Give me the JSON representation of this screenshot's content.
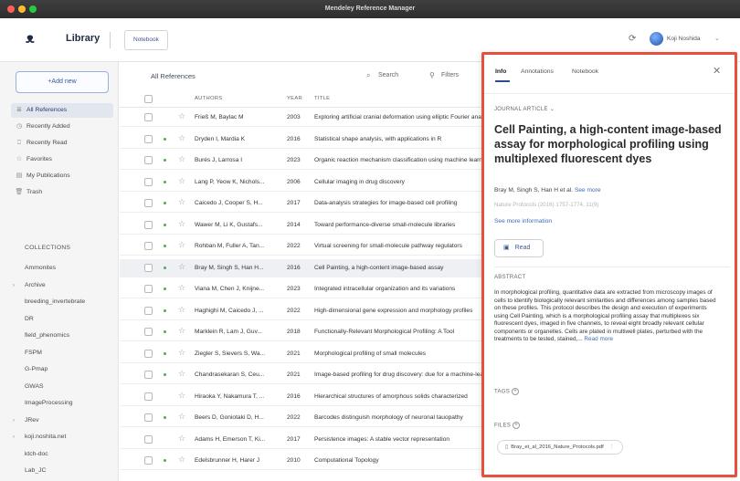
{
  "window": {
    "title": "Mendeley Reference Manager"
  },
  "header": {
    "library_label": "Library",
    "notebook_tab": "Notebook",
    "user_name": "Koji Noshida"
  },
  "sidebar": {
    "add_new": "+Add new",
    "nav": [
      {
        "label": "All References",
        "icon": "list-icon",
        "active": true
      },
      {
        "label": "Recently Added",
        "icon": "clock-icon"
      },
      {
        "label": "Recently Read",
        "icon": "bookmark-icon"
      },
      {
        "label": "Favorites",
        "icon": "star-icon"
      },
      {
        "label": "My Publications",
        "icon": "document-icon"
      },
      {
        "label": "Trash",
        "icon": "trash-icon"
      }
    ],
    "collections_heading": "COLLECTIONS",
    "collections": [
      {
        "label": "Ammonites",
        "caret": false
      },
      {
        "label": "Archive",
        "caret": true
      },
      {
        "label": "breeding_invertebrate",
        "caret": false
      },
      {
        "label": "DR",
        "caret": false
      },
      {
        "label": "field_phenomics",
        "caret": false
      },
      {
        "label": "FSPM",
        "caret": false
      },
      {
        "label": "G-Pmap",
        "caret": false
      },
      {
        "label": "GWAS",
        "caret": false
      },
      {
        "label": "ImageProcessing",
        "caret": false
      },
      {
        "label": "JRev",
        "caret": true
      },
      {
        "label": "koji.noshita.net",
        "caret": true
      },
      {
        "label": "ktch-doc",
        "caret": false
      },
      {
        "label": "Lab_JC",
        "caret": false
      }
    ]
  },
  "list": {
    "title": "All References",
    "search_label": "Search",
    "filters_label": "Filters",
    "columns": {
      "authors": "AUTHORS",
      "year": "YEAR",
      "title": "TITLE"
    },
    "rows": [
      {
        "authors": "Frieß M, Baylac M",
        "year": "2003",
        "title": "Exploring artificial cranial deformation using elliptic Fourier analysis",
        "dot": false
      },
      {
        "authors": "Dryden I, Mardia K",
        "year": "2016",
        "title": "Statistical shape analysis, with applications in R",
        "dot": true
      },
      {
        "authors": "Burés J, Larrosa I",
        "year": "2023",
        "title": "Organic reaction mechanism classification using machine learning",
        "dot": true
      },
      {
        "authors": "Lang P, Yeow K, Nichols...",
        "year": "2006",
        "title": "Cellular imaging in drug discovery",
        "dot": true
      },
      {
        "authors": "Caicedo J, Cooper S, H...",
        "year": "2017",
        "title": "Data-analysis strategies for image-based cell profiling",
        "dot": true
      },
      {
        "authors": "Wawer M, Li K, Gustafs...",
        "year": "2014",
        "title": "Toward performance-diverse small-molecule libraries",
        "dot": true
      },
      {
        "authors": "Rohban M, Fuller A, Tan...",
        "year": "2022",
        "title": "Virtual screening for small-molecule pathway regulators",
        "dot": true
      },
      {
        "authors": "Bray M, Singh S, Han H...",
        "year": "2016",
        "title": "Cell Painting, a high-content image-based assay",
        "dot": true,
        "selected": true
      },
      {
        "authors": "Viana M, Chen J, Knijne...",
        "year": "2023",
        "title": "Integrated intracellular organization and its variations",
        "dot": true
      },
      {
        "authors": "Haghighi M, Caicedo J, ...",
        "year": "2022",
        "title": "High-dimensional gene expression and morphology profiles",
        "dot": true
      },
      {
        "authors": "Marklein R, Lam J, Guv...",
        "year": "2018",
        "title": "Functionally-Relevant Morphological Profiling: A Tool",
        "dot": true
      },
      {
        "authors": "Ziegler S, Sievers S, Wa...",
        "year": "2021",
        "title": "Morphological profiling of small molecules",
        "dot": true
      },
      {
        "authors": "Chandrasekaran S, Ceu...",
        "year": "2021",
        "title": "Image-based profiling for drug discovery: due for a machine-learning upgrade?",
        "dot": true
      },
      {
        "authors": "Hiraoka Y, Nakamura T, ...",
        "year": "2016",
        "title": "Hierarchical structures of amorphous solids characterized",
        "dot": false
      },
      {
        "authors": "Beers D, Goniotaki D, H...",
        "year": "2022",
        "title": "Barcodes distinguish morphology of neuronal tauopathy",
        "dot": true
      },
      {
        "authors": "Adams H, Emerson T, Ki...",
        "year": "2017",
        "title": "Persistence images: A stable vector representation",
        "dot": false
      },
      {
        "authors": "Edelsbrunner H, Harer J",
        "year": "2010",
        "title": "Computational Topology",
        "dot": true
      }
    ]
  },
  "detail": {
    "tabs": [
      "Info",
      "Annotations",
      "Notebook"
    ],
    "doc_type": "JOURNAL ARTICLE",
    "title": "Cell Painting, a high-content image-based assay for morphological profiling using multiplexed fluorescent dyes",
    "authors": "Bray M, Singh S, Han H et al.",
    "see_more_authors": "See more",
    "citation": "Nature Protocols (2016) 1757-1774, 11(9)",
    "see_more_info": "See more information",
    "read_button": "Read",
    "abstract_heading": "ABSTRACT",
    "abstract": "In morphological profiling, quantitative data are extracted from microscopy images of cells to identify biologically relevant similarities and differences among samples based on these profiles. This protocol describes the design and execution of experiments using Cell Painting, which is a morphological profiling assay that multiplexes six fluorescent dyes, imaged in five channels, to reveal eight broadly relevant cellular components or organelles. Cells are plated in multiwell plates, perturbed with the treatments to be tested, stained,...",
    "read_more": "Read more",
    "tags_heading": "TAGS",
    "files_heading": "FILES",
    "file_name": "Bray_et_al_2016_Nature_Protocols.pdf"
  },
  "colors": {
    "highlight_border": "#e6503f",
    "accent": "#3e6bb8",
    "status_dot": "#4caf50"
  }
}
